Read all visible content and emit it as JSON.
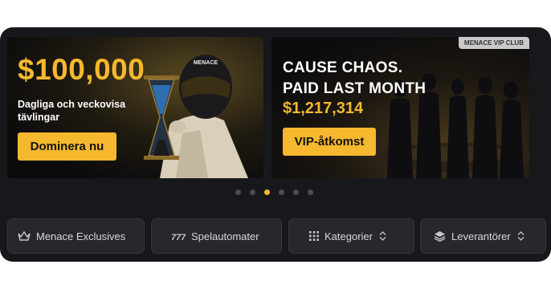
{
  "banners": [
    {
      "amount": "$100,000",
      "tagline": "Dagliga och veckovisa tävlingar",
      "cta": "Dominera nu",
      "helmet_text": "MENACE"
    },
    {
      "badge": "MENACE VIP CLUB",
      "headline_line1": "CAUSE CHAOS.",
      "headline_line2": "PAID LAST MONTH",
      "jackpot": "$1,217,314",
      "cta": "VIP-åtkomst"
    }
  ],
  "carousel": {
    "total": 6,
    "active": 3
  },
  "nav": [
    {
      "label": "Menace Exclusives",
      "icon": "crown-icon"
    },
    {
      "label": "Spelautomater",
      "icon": "slot-777-icon"
    },
    {
      "label": "Kategorier",
      "icon": "grid-icon"
    },
    {
      "label": "Leverantörer",
      "icon": "layers-icon"
    }
  ],
  "colors": {
    "accent": "#f5b82e",
    "background": "#17181c",
    "button": "#26282e"
  }
}
